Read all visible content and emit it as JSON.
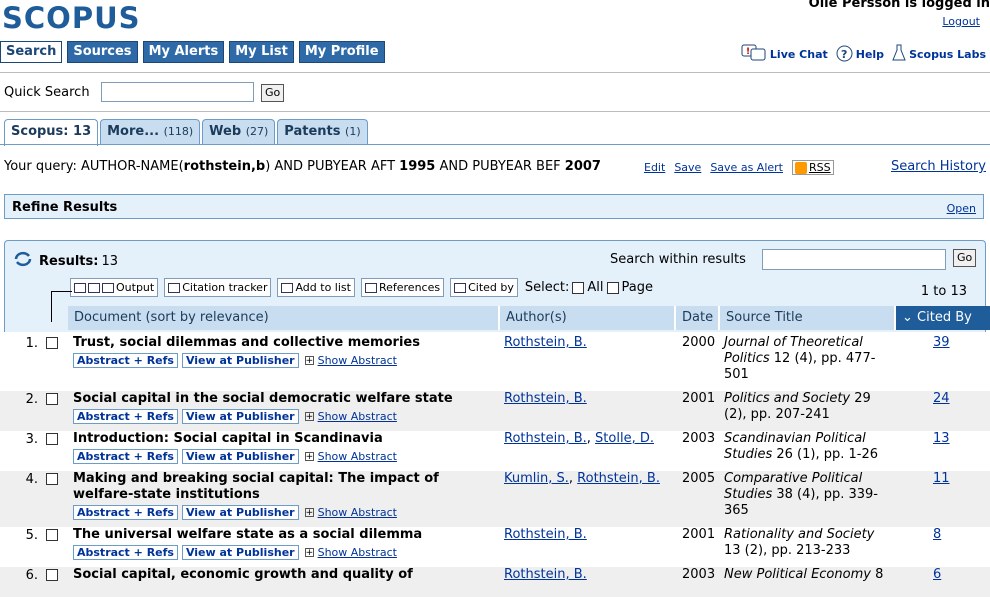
{
  "header": {
    "logo": "SCOPUS",
    "logged_in": "Olle Persson is logged in",
    "logout": "Logout"
  },
  "nav": [
    {
      "label": "Search",
      "active": true
    },
    {
      "label": "Sources"
    },
    {
      "label": "My Alerts"
    },
    {
      "label": "My List"
    },
    {
      "label": "My Profile"
    }
  ],
  "toplinks": {
    "live_chat": "Live Chat",
    "help": "Help",
    "labs": "Scopus Labs"
  },
  "quick_search": {
    "label": "Quick Search",
    "value": "",
    "go": "Go"
  },
  "result_tabs": [
    {
      "label": "Scopus: 13",
      "count": ""
    },
    {
      "label": "More...",
      "count": "(118)"
    },
    {
      "label": "Web",
      "count": "(27)"
    },
    {
      "label": "Patents",
      "count": "(1)"
    }
  ],
  "query": {
    "prefix": "Your query: AUTHOR-NAME(",
    "author": "rothstein,b",
    "mid1": ") AND PUBYEAR AFT ",
    "year1": "1995",
    "mid2": " AND PUBYEAR BEF ",
    "year2": "2007",
    "edit": "Edit",
    "save": "Save",
    "save_alert": "Save as Alert",
    "rss": "RSS",
    "history": "Search History"
  },
  "refine": {
    "title": "Refine Results",
    "open": "Open"
  },
  "results": {
    "label": "Results:",
    "count": "13",
    "search_within": "Search within results",
    "go": "Go",
    "range": "1 to 13",
    "toolbar": {
      "output": "Output",
      "citation": "Citation tracker",
      "add": "Add to list",
      "refs": "References",
      "cited": "Cited by",
      "select": "Select:",
      "all": "All",
      "page": "Page"
    }
  },
  "columns": {
    "document": "Document (sort by relevance)",
    "authors": "Author(s)",
    "date": "Date",
    "source": "Source Title",
    "cited": "Cited By"
  },
  "row_buttons": {
    "abstract": "Abstract + Refs",
    "publisher": "View at Publisher",
    "show": "Show Abstract"
  },
  "rows": [
    {
      "n": "1.",
      "title": "Trust, social dilemmas and collective memories",
      "authors": [
        "Rothstein, B."
      ],
      "date": "2000",
      "source_journal": "Journal of Theoretical Politics",
      "source_rest": " 12 (4), pp. 477-501",
      "cited": "39"
    },
    {
      "n": "2.",
      "title": "Social capital in the social democratic welfare state",
      "authors": [
        "Rothstein, B."
      ],
      "date": "2001",
      "source_journal": "Politics and Society",
      "source_rest": " 29 (2), pp. 207-241",
      "cited": "24"
    },
    {
      "n": "3.",
      "title": "Introduction: Social capital in Scandinavia",
      "authors": [
        "Rothstein, B.",
        "Stolle, D."
      ],
      "date": "2003",
      "source_journal": "Scandinavian Political Studies",
      "source_rest": " 26 (1), pp. 1-26",
      "cited": "13"
    },
    {
      "n": "4.",
      "title": "Making and breaking social capital: The impact of welfare-state institutions",
      "authors": [
        "Kumlin, S.",
        "Rothstein, B."
      ],
      "date": "2005",
      "source_journal": "Comparative Political Studies",
      "source_rest": " 38 (4), pp. 339-365",
      "cited": "11"
    },
    {
      "n": "5.",
      "title": "The universal welfare state as a social dilemma",
      "authors": [
        "Rothstein, B."
      ],
      "date": "2001",
      "source_journal": "Rationality and Society",
      "source_rest": " 13 (2), pp. 213-233",
      "cited": "8"
    },
    {
      "n": "6.",
      "title": "Social capital, economic growth and quality of",
      "authors": [
        "Rothstein, B."
      ],
      "date": "2003",
      "source_journal": "New Political Economy",
      "source_rest": " 8",
      "cited": "6"
    }
  ]
}
